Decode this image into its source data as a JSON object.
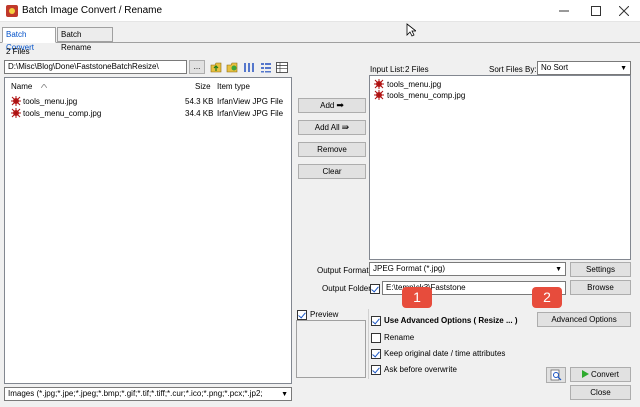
{
  "window": {
    "title": "Batch Image Convert / Rename"
  },
  "tabs": [
    {
      "label": "Batch Convert",
      "active": true
    },
    {
      "label": "Batch Rename",
      "active": false
    }
  ],
  "browser": {
    "file_count": "2 Files",
    "path": "D:\\Misc\\Blog\\Done\\FaststoneBatchResize\\",
    "browse_label": "...",
    "columns": {
      "name": "Name",
      "size": "Size",
      "type": "Item type"
    },
    "files": [
      {
        "name": "tools_menu.jpg",
        "size": "54.3 KB",
        "type": "IrfanView JPG File"
      },
      {
        "name": "tools_menu_comp.jpg",
        "size": "34.4 KB",
        "type": "IrfanView JPG File"
      }
    ],
    "filter": "Images (*.jpg;*.jpe;*.jpeg;*.bmp;*.gif;*.tif;*.tiff;*.cur;*.ico;*.png;*.pcx;*.jp2;"
  },
  "actions": {
    "add": "Add",
    "add_all": "Add All",
    "remove": "Remove",
    "clear": "Clear"
  },
  "input_list": {
    "label": "Input List:",
    "count": "2 Files",
    "sort_label": "Sort Files By:",
    "sort_value": "No Sort",
    "files": [
      "tools_menu.jpg",
      "tools_menu_comp.jpg"
    ]
  },
  "output": {
    "format_label": "Output Format:",
    "format_value": "JPEG Format (*.jpg)",
    "settings": "Settings",
    "folder_label": "Output Folder:",
    "folder_value": "E:\\temp\\ck3\\Faststone",
    "browse": "Browse"
  },
  "preview": {
    "label": "Preview",
    "checked": true
  },
  "options": {
    "advanced": {
      "label": "Use Advanced Options ( Resize ... )",
      "checked": true
    },
    "advanced_button": "Advanced Options",
    "rename": {
      "label": "Rename",
      "checked": false
    },
    "keep_date": {
      "label": "Keep original date / time attributes",
      "checked": true
    },
    "ask_overwrite": {
      "label": "Ask before overwrite",
      "checked": true
    }
  },
  "buttons": {
    "convert": "Convert",
    "close": "Close"
  },
  "annotations": [
    "1",
    "2"
  ],
  "colors": {
    "accent": "#0050c8",
    "badge": "#e74c3c",
    "convert_arrow": "#2eaa2e"
  }
}
